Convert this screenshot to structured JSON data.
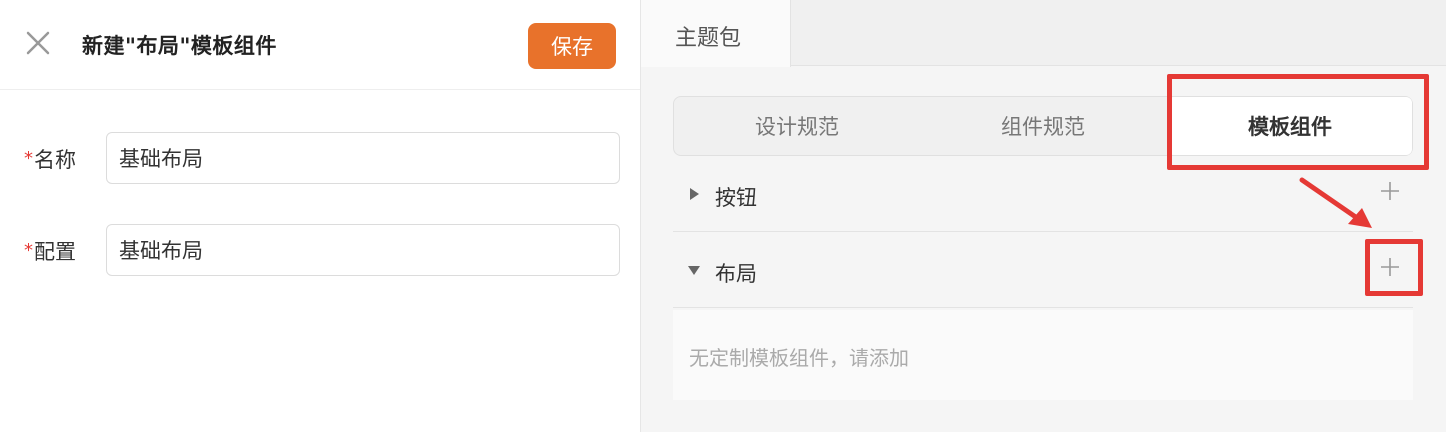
{
  "dialog": {
    "title": "新建\"布局\"模板组件",
    "save_label": "保存"
  },
  "form": {
    "name_label": "名称",
    "name_value": "基础布局",
    "config_label": "配置",
    "config_value": "基础布局",
    "required_mark": "*"
  },
  "right": {
    "tab_title": "主题包",
    "segments": [
      "设计规范",
      "组件规范",
      "模板组件"
    ],
    "active_segment": "模板组件",
    "groups": [
      {
        "label": "按钮",
        "expanded": false
      },
      {
        "label": "布局",
        "expanded": true
      }
    ],
    "empty_text": "无定制模板组件，请添加"
  },
  "colors": {
    "accent": "#e8722b",
    "highlight": "#e53935"
  }
}
